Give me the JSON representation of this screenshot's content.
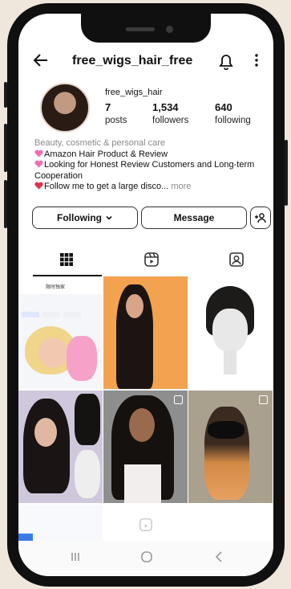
{
  "profile": {
    "title_username": "free_wigs_hair_free",
    "display_handle": "free_wigs_hair",
    "stats": [
      {
        "value": "7",
        "label": "posts"
      },
      {
        "value": "1,534",
        "label": "followers"
      },
      {
        "value": "640",
        "label": "following"
      }
    ],
    "category": "Beauty, cosmetic & personal care",
    "bio_lines": [
      "Amazon Hair Product & Review",
      "Looking for Honest Review Customers and Long-term Cooperation",
      "Follow me to get a large disco..."
    ],
    "more_label": "more"
  },
  "actions": {
    "following_label": "Following",
    "message_label": "Message"
  },
  "tabs": [
    {
      "name": "grid-icon",
      "active": true
    },
    {
      "name": "reels-icon",
      "active": false
    },
    {
      "name": "tagged-icon",
      "active": false
    }
  ],
  "grid_posts": [
    {
      "name": "post-doll-promo",
      "text": "限时独家"
    },
    {
      "name": "post-woman-long-hair",
      "text": ""
    },
    {
      "name": "post-hair-topper",
      "text": ""
    },
    {
      "name": "post-bangs-mannequin",
      "text": ""
    },
    {
      "name": "post-curtain-bangs",
      "text": ""
    },
    {
      "name": "post-model-black-hair",
      "text": ""
    },
    {
      "name": "post-bow-hair",
      "text": ""
    }
  ],
  "colors": {
    "accent_pink": "#e84f9a",
    "bio_heart_pink": "#f06fb0",
    "bio_heart_red": "#e2304c",
    "background": "#efe6dc",
    "phone_frame": "#101010"
  },
  "nav": {
    "icons": [
      "recent-apps-icon",
      "home-icon",
      "back-icon"
    ]
  }
}
